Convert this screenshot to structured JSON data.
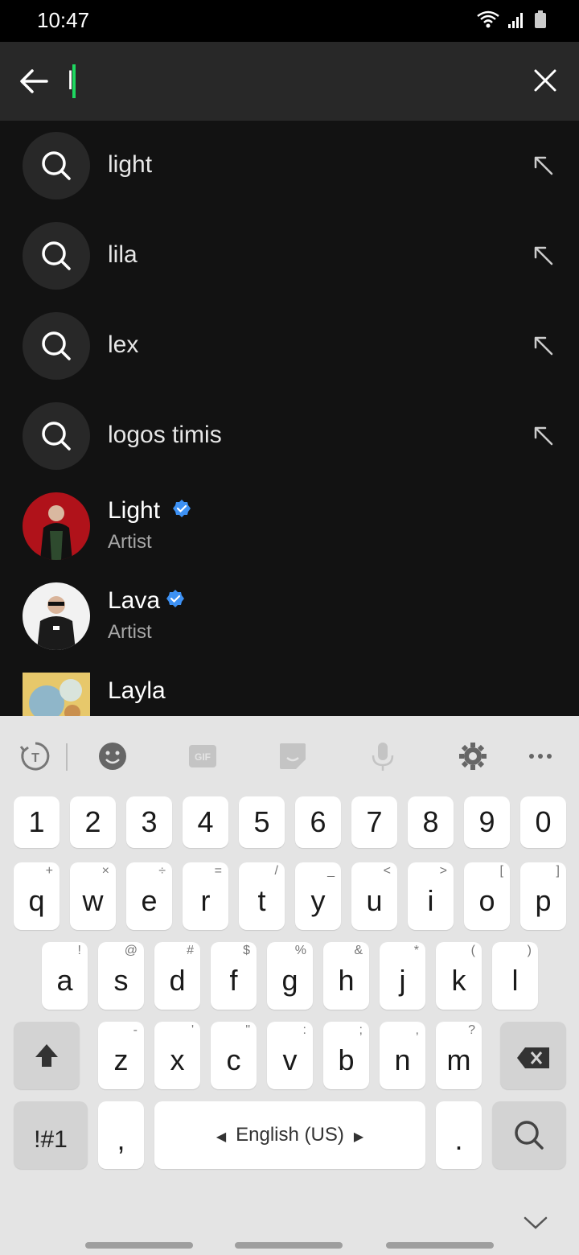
{
  "status_bar": {
    "time": "10:47"
  },
  "search": {
    "query": "l"
  },
  "suggestions": [
    {
      "text": "light"
    },
    {
      "text": "lila"
    },
    {
      "text": "lex"
    },
    {
      "text": "logos timis"
    }
  ],
  "artists": [
    {
      "name": "Light",
      "subtitle": "Artist"
    },
    {
      "name": "Lava",
      "subtitle": "Artist"
    }
  ],
  "album": {
    "name": "Layla"
  },
  "keyboard": {
    "number_row": [
      "1",
      "2",
      "3",
      "4",
      "5",
      "6",
      "7",
      "8",
      "9",
      "0"
    ],
    "row1": [
      {
        "k": "q",
        "h": "+"
      },
      {
        "k": "w",
        "h": "×"
      },
      {
        "k": "e",
        "h": "÷"
      },
      {
        "k": "r",
        "h": "="
      },
      {
        "k": "t",
        "h": "/"
      },
      {
        "k": "y",
        "h": "_"
      },
      {
        "k": "u",
        "h": "<"
      },
      {
        "k": "i",
        "h": ">"
      },
      {
        "k": "o",
        "h": "["
      },
      {
        "k": "p",
        "h": "]"
      }
    ],
    "row2": [
      {
        "k": "a",
        "h": "!"
      },
      {
        "k": "s",
        "h": "@"
      },
      {
        "k": "d",
        "h": "#"
      },
      {
        "k": "f",
        "h": "$"
      },
      {
        "k": "g",
        "h": "%"
      },
      {
        "k": "h",
        "h": "&"
      },
      {
        "k": "j",
        "h": "*"
      },
      {
        "k": "k",
        "h": "("
      },
      {
        "k": "l",
        "h": ")"
      }
    ],
    "row3": [
      {
        "k": "z",
        "h": "-"
      },
      {
        "k": "x",
        "h": "'"
      },
      {
        "k": "c",
        "h": "\""
      },
      {
        "k": "v",
        "h": ":"
      },
      {
        "k": "b",
        "h": ";"
      },
      {
        "k": "n",
        "h": ","
      },
      {
        "k": "m",
        "h": "?"
      }
    ],
    "symbols_label": "!#1",
    "comma": ",",
    "space_label": "English (US)",
    "period": "."
  },
  "colors": {
    "accent": "#1ed760",
    "verified": "#3d91f4",
    "background": "#121212",
    "header": "#282828",
    "keyboard_bg": "#e4e4e4"
  }
}
